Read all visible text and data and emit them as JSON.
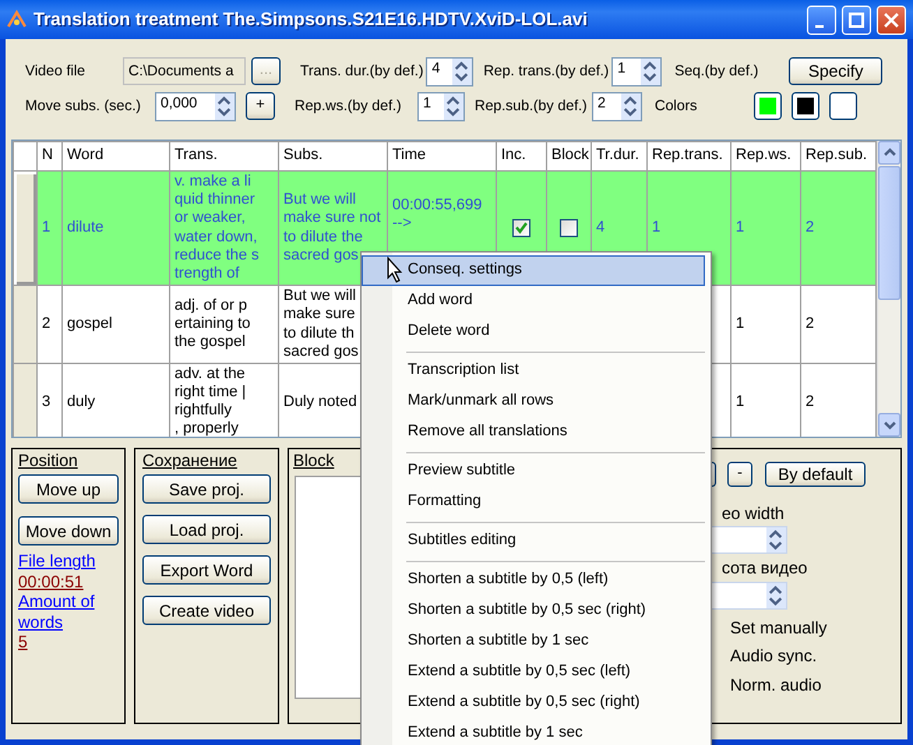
{
  "window": {
    "title": "Translation treatment The.Simpsons.S21E16.HDTV.XviD-LOL.avi"
  },
  "settings": {
    "video_file_label": "Video file",
    "video_file_value": "C:\\Documents a",
    "browse_button": "...",
    "move_subs_label": "Move subs. (sec.)",
    "move_subs_value": "0,000",
    "plus_button": "+",
    "spins": [
      {
        "label": "Trans. dur.(by def.)",
        "value": "4"
      },
      {
        "label": "Rep. trans.(by def.)",
        "value": "1"
      },
      {
        "label": "Rep.ws.(by def.)",
        "value": "1"
      },
      {
        "label": "Rep.sub.(by def.)",
        "value": "2"
      }
    ],
    "seq_label": "Seq.(by def.)",
    "specify_button": "Specify",
    "colors_label": "Colors",
    "colors": [
      {
        "color": "#00ff00"
      },
      {
        "color": "#000000"
      },
      {
        "color": "#ffffff"
      }
    ]
  },
  "table": {
    "columns": [
      "N",
      "Word",
      "Trans.",
      "Subs.",
      "Time",
      "Inc.",
      "Block",
      "Tr.dur.",
      "Rep.trans.",
      "Rep.ws.",
      "Rep.sub."
    ],
    "rows": [
      {
        "selected": true,
        "n": "1",
        "word": "dilute",
        "trans": "v. make a li\nquid thinner\n or weaker,\nwater down,\nreduce the s\ntrength of",
        "subs": "But we will\nmake sure not\nto dilute the\nsacred gos",
        "time": "00:00:55,699\n-->",
        "inc": true,
        "block": false,
        "tr_dur": "4",
        "rep_trans": "1",
        "rep_ws": "1",
        "rep_sub": "2"
      },
      {
        "selected": false,
        "n": "2",
        "word": "gospel",
        "trans": "adj. of or p\nertaining to\n the gospel",
        "subs": "But we will\nmake sure\nto dilute th\nsacred gos",
        "rep_ws": "1",
        "rep_sub": "2"
      },
      {
        "selected": false,
        "n": "3",
        "word": "duly",
        "trans": "adv. at the\nright time |\n  rightfully\n, properly",
        "subs": "Duly noted",
        "rep_ws": "1",
        "rep_sub": "2"
      }
    ]
  },
  "position": {
    "legend": "Position",
    "buttons": [
      "Move up",
      "Move down"
    ],
    "file_length_label": "File length",
    "file_length": "00:00:51",
    "words_label": "Amount of words",
    "words": "5"
  },
  "saving": {
    "legend": "Сохранение",
    "buttons": [
      "Save proj.",
      "Load proj.",
      "Export Word",
      "Create video"
    ]
  },
  "block": {
    "legend": "Block"
  },
  "video": {
    "minus_button": "-",
    "default_button": "By default",
    "width_label": "eo width",
    "height_label": "сота видео",
    "options": [
      "Set manually",
      "Audio sync.",
      "Norm. audio"
    ]
  },
  "context_menu": [
    {
      "kind": "item",
      "label": "Conseq. settings",
      "selected": true
    },
    {
      "kind": "item",
      "label": "Add word",
      "selected": false
    },
    {
      "kind": "item",
      "label": "Delete word",
      "selected": false
    },
    {
      "kind": "separator"
    },
    {
      "kind": "item",
      "label": "Transcription list",
      "selected": false
    },
    {
      "kind": "item",
      "label": "Mark/unmark all rows",
      "selected": false
    },
    {
      "kind": "item",
      "label": "Remove all translations",
      "selected": false
    },
    {
      "kind": "separator"
    },
    {
      "kind": "item",
      "label": "Preview subtitle",
      "selected": false
    },
    {
      "kind": "item",
      "label": "Formatting",
      "selected": false
    },
    {
      "kind": "separator"
    },
    {
      "kind": "item",
      "label": "Subtitles editing",
      "selected": false
    },
    {
      "kind": "separator"
    },
    {
      "kind": "item",
      "label": "Shorten a subtitle by 0,5 (left)",
      "selected": false
    },
    {
      "kind": "item",
      "label": "Shorten a subtitle by 0,5 sec (right)",
      "selected": false
    },
    {
      "kind": "item",
      "label": "Shorten a subtitle by 1 sec",
      "selected": false
    },
    {
      "kind": "item",
      "label": "Extend a subtitle by 0,5 sec (left)",
      "selected": false
    },
    {
      "kind": "item",
      "label": "Extend a subtitle by 0,5 sec (right)",
      "selected": false
    },
    {
      "kind": "item",
      "label": "Extend a subtitle by 1 sec",
      "selected": false
    }
  ]
}
